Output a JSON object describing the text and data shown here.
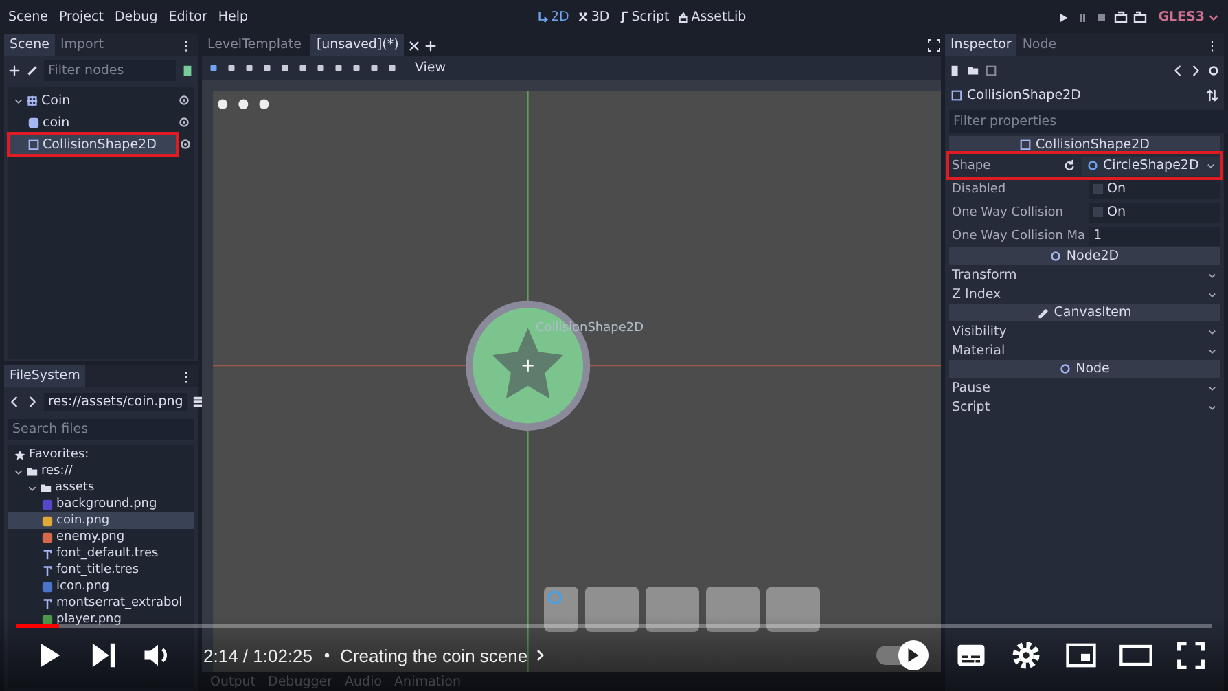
{
  "menu": [
    "Scene",
    "Project",
    "Debug",
    "Editor",
    "Help"
  ],
  "workspaces": [
    {
      "label": "2D",
      "kind": "flat",
      "selected": true
    },
    {
      "label": "3D",
      "kind": "spatial",
      "selected": false
    },
    {
      "label": "Script",
      "kind": "script",
      "selected": false
    },
    {
      "label": "AssetLib",
      "kind": "assetlib",
      "selected": false
    }
  ],
  "renderer": "GLES3",
  "scene_dock": {
    "tabs": [
      {
        "label": "Scene",
        "selected": true
      },
      {
        "label": "Import",
        "selected": false
      }
    ],
    "filter_placeholder": "Filter nodes",
    "tree": [
      {
        "label": "Coin",
        "kind": "node2d",
        "selected": false,
        "outlined": false,
        "expanded": true,
        "children": [
          {
            "label": "coin",
            "kind": "sprite",
            "selected": false,
            "outlined": false
          },
          {
            "label": "CollisionShape2D",
            "kind": "shape",
            "selected": true,
            "outlined": true
          }
        ]
      }
    ]
  },
  "filesystem": {
    "tab": "FileSystem",
    "path": "res://assets/coin.png",
    "search_placeholder": "Search files",
    "tree": [
      {
        "label": "Favorites:",
        "kind": "favorites",
        "selected": false
      },
      {
        "label": "res://",
        "kind": "folder",
        "selected": false,
        "expanded": true,
        "children": [
          {
            "label": "assets",
            "kind": "folder",
            "selected": false,
            "expanded": true,
            "children": [
              {
                "label": "background.png",
                "kind": "image",
                "color": "#5548c8",
                "selected": false
              },
              {
                "label": "coin.png",
                "kind": "image",
                "color": "#e0a838",
                "selected": true
              },
              {
                "label": "enemy.png",
                "kind": "image",
                "color": "#d8684a",
                "selected": false
              },
              {
                "label": "font_default.tres",
                "kind": "font",
                "selected": false
              },
              {
                "label": "font_title.tres",
                "kind": "font",
                "selected": false
              },
              {
                "label": "icon.png",
                "kind": "image",
                "color": "#4a74c8",
                "selected": false
              },
              {
                "label": "montserrat_extrabol",
                "kind": "font",
                "selected": false
              },
              {
                "label": "player.png",
                "kind": "image",
                "color": "#4e9a4a",
                "selected": false
              }
            ]
          }
        ]
      }
    ]
  },
  "editor_tabs": [
    {
      "label": "LevelTemplate",
      "selected": false
    },
    {
      "label": "[unsaved](*)",
      "selected": true
    }
  ],
  "toolbar": {
    "view_menu": "View"
  },
  "canvas": {
    "node_label": "CollisionShape2D"
  },
  "bottom_tabs": [
    "Output",
    "Debugger",
    "Audio",
    "Animation"
  ],
  "inspector": {
    "tabs": [
      {
        "label": "Inspector",
        "selected": true
      },
      {
        "label": "Node",
        "selected": false
      }
    ],
    "object": "CollisionShape2D",
    "filter_placeholder": "Filter properties",
    "rows": [
      {
        "kind": "header",
        "label": "CollisionShape2D"
      },
      {
        "kind": "resource",
        "label": "Shape",
        "value": "CircleShape2D",
        "outlined": true
      },
      {
        "kind": "check",
        "label": "Disabled",
        "value": "On",
        "checked": false
      },
      {
        "kind": "check",
        "label": "One Way Collision",
        "value": "On",
        "checked": false
      },
      {
        "kind": "number",
        "label": "One Way Collision Ma",
        "value": "1"
      },
      {
        "kind": "header",
        "label": "Node2D"
      },
      {
        "kind": "group",
        "label": "Transform"
      },
      {
        "kind": "group",
        "label": "Z Index"
      },
      {
        "kind": "header",
        "label": "CanvasItem"
      },
      {
        "kind": "group",
        "label": "Visibility"
      },
      {
        "kind": "group",
        "label": "Material"
      },
      {
        "kind": "header",
        "label": "Node"
      },
      {
        "kind": "group",
        "label": "Pause"
      },
      {
        "kind": "group",
        "label": "Script"
      }
    ]
  },
  "player": {
    "level": 0.036,
    "time": "2:14 / 1:02:25",
    "chapter": "Creating the coin scene",
    "autoplay": true
  }
}
